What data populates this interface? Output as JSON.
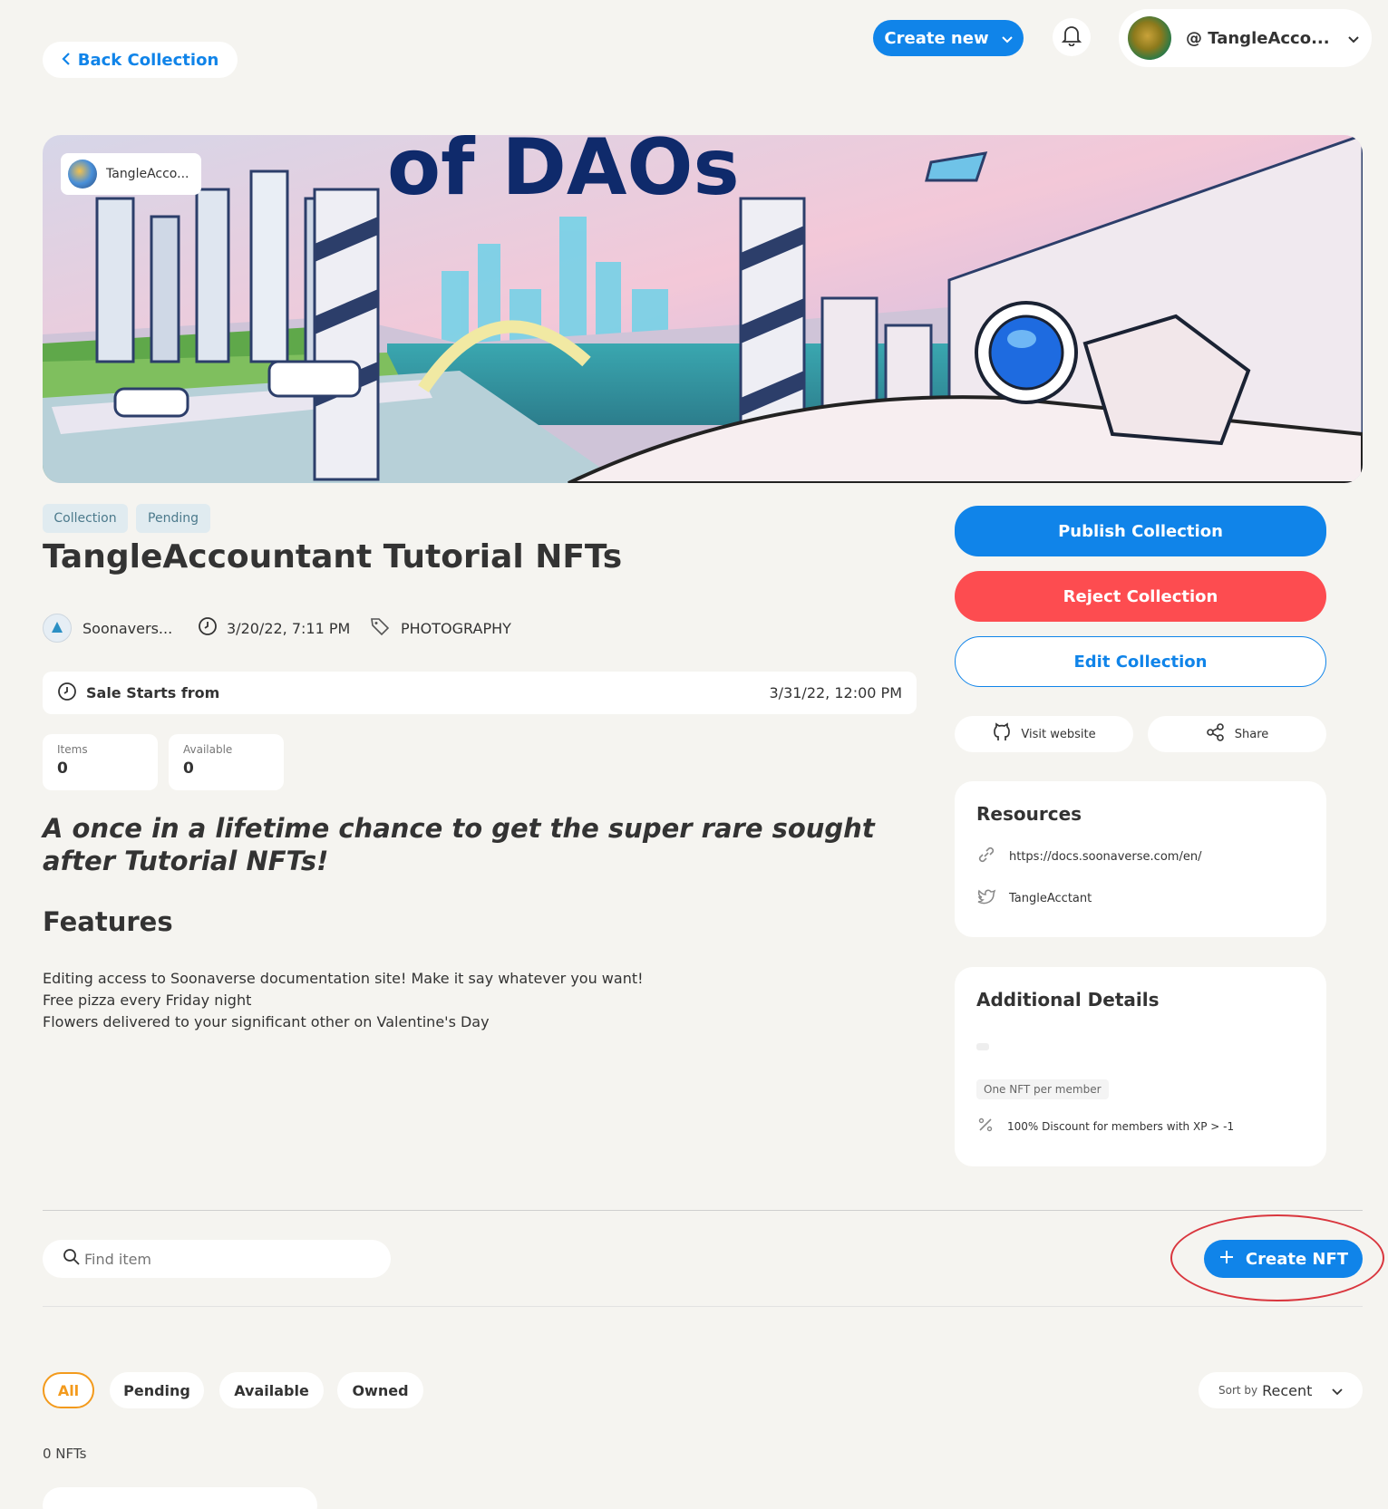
{
  "header": {
    "back_label": "Back Collection",
    "create_new_label": "Create new",
    "account_name": "@ TangleAcco..."
  },
  "banner": {
    "owner_label": "TangleAcco...",
    "art_text": "of DAOs"
  },
  "collection": {
    "tags": [
      "Collection",
      "Pending"
    ],
    "title": "TangleAccountant Tutorial NFTs",
    "creator": "Soonavers...",
    "created_at": "3/20/22, 7:11 PM",
    "category": "PHOTOGRAPHY",
    "sale_label": "Sale Starts from",
    "sale_date": "3/31/22, 12:00 PM",
    "items_label": "Items",
    "items_value": "0",
    "available_label": "Available",
    "available_value": "0",
    "tagline": "A once in a lifetime chance to get the super rare sought after Tutorial NFTs!",
    "features_heading": "Features",
    "features": [
      "Editing access to Soonaverse documentation site! Make it say whatever you want!",
      "Free pizza every Friday night",
      "Flowers delivered to your significant other on Valentine's Day"
    ]
  },
  "actions": {
    "publish_label": "Publish Collection",
    "reject_label": "Reject Collection",
    "edit_label": "Edit Collection",
    "visit_label": "Visit website",
    "share_label": "Share"
  },
  "resources": {
    "heading": "Resources",
    "link": "https://docs.soonaverse.com/en/",
    "twitter": "TangleAcctant"
  },
  "details": {
    "heading": "Additional Details",
    "limit_badge": "One NFT per member",
    "discount": "100% Discount for members with XP > -1"
  },
  "toolbar": {
    "search_placeholder": "Find item",
    "create_nft_label": "Create NFT"
  },
  "filters": {
    "items": [
      "All",
      "Pending",
      "Available",
      "Owned"
    ],
    "sort_prefix": "Sort by",
    "sort_value": "Recent",
    "count_label": "0 NFTs"
  },
  "colors": {
    "primary": "#1084e9",
    "danger": "#fd4c50",
    "active_filter": "#f39a1c",
    "annotation": "#d9363e"
  }
}
